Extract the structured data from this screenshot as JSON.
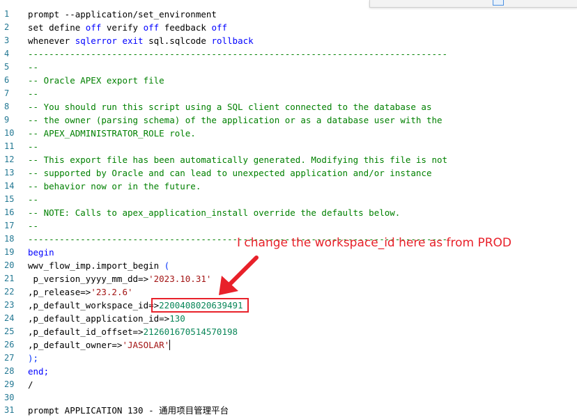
{
  "line_numbers": [
    "1",
    "2",
    "3",
    "4",
    "5",
    "6",
    "7",
    "8",
    "9",
    "10",
    "11",
    "12",
    "13",
    "14",
    "15",
    "16",
    "17",
    "18",
    "19",
    "20",
    "21",
    "22",
    "23",
    "24",
    "25",
    "26",
    "27",
    "28",
    "29",
    "30",
    "31"
  ],
  "code": {
    "l1_a": "prompt --application/set_environment",
    "l2_a": "set define ",
    "l2_b": "off",
    "l2_c": " verify ",
    "l2_d": "off",
    "l2_e": " feedback ",
    "l2_f": "off",
    "l3_a": "whenever ",
    "l3_b": "sqlerror",
    "l3_c": " ",
    "l3_d": "exit",
    "l3_e": " sql.sqlcode ",
    "l3_f": "rollback",
    "l4": "--------------------------------------------------------------------------------",
    "l5": "--",
    "l6": "-- Oracle APEX export file",
    "l7": "--",
    "l8": "-- You should run this script using a SQL client connected to the database as",
    "l9": "-- the owner (parsing schema) of the application or as a database user with the",
    "l10": "-- APEX_ADMINISTRATOR_ROLE role.",
    "l11": "--",
    "l12": "-- This export file has been automatically generated. Modifying this file is not",
    "l13": "-- supported by Oracle and can lead to unexpected application and/or instance",
    "l14": "-- behavior now or in the future.",
    "l15": "--",
    "l16": "-- NOTE: Calls to apex_application_install override the defaults below.",
    "l17": "--",
    "l18": "--------------------------------------------------------------------------------",
    "l19": "begin",
    "l20_a": "wwv_flow_imp.import_begin ",
    "l20_b": "(",
    "l21_a": " p_version_yyyy_mm_dd=>",
    "l21_b": "'2023.10.31'",
    "l22_a": ",p_release=>",
    "l22_b": "'23.2.6'",
    "l23_a": ",p_default_workspace_id=>",
    "l23_b": "2200408020639491",
    "l24_a": ",p_default_application_id=>",
    "l24_b": "130",
    "l25_a": ",p_default_id_offset=>",
    "l25_b": "212601670514570198",
    "l26_a": ",p_default_owner=>",
    "l26_b": "'JASOLAR'",
    "l27": ");",
    "l28": "end;",
    "l29": "/",
    "l30": "",
    "l31_a": "prompt APPLICATION 130 - ",
    "l31_b": "通用项目管理平台"
  },
  "annotation": {
    "text": "I change the workspace_id here as from PROD",
    "color": "#e8212a"
  },
  "colors": {
    "keyword": "#0000ff",
    "comment": "#008000",
    "string": "#a31515",
    "number": "#098658",
    "line_number": "#237893"
  }
}
